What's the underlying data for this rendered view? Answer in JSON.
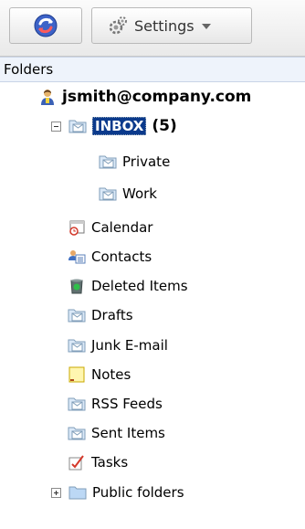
{
  "toolbar": {
    "refresh_icon": "refresh-icon",
    "settings_label": "Settings",
    "settings_icon": "settings-icon"
  },
  "folders_header": "Folders",
  "account": {
    "label": "jsmith@company.com",
    "icon": "user-icon"
  },
  "inbox": {
    "label": "INBOX",
    "count": "(5)",
    "expanded": true
  },
  "inbox_children": [
    {
      "label": "Private",
      "icon": "mail-folder-icon"
    },
    {
      "label": "Work",
      "icon": "mail-folder-icon"
    }
  ],
  "folders": [
    {
      "label": "Calendar",
      "icon": "calendar-icon"
    },
    {
      "label": "Contacts",
      "icon": "contacts-icon"
    },
    {
      "label": "Deleted Items",
      "icon": "recycle-bin-icon"
    },
    {
      "label": "Drafts",
      "icon": "mail-folder-icon"
    },
    {
      "label": "Junk E-mail",
      "icon": "mail-folder-icon"
    },
    {
      "label": "Notes",
      "icon": "notes-icon"
    },
    {
      "label": "RSS Feeds",
      "icon": "mail-folder-icon"
    },
    {
      "label": "Sent Items",
      "icon": "mail-folder-icon"
    },
    {
      "label": "Tasks",
      "icon": "tasks-icon"
    }
  ],
  "public_folders": {
    "label": "Public folders",
    "expanded": false,
    "icon": "folder-icon"
  },
  "colors": {
    "selection": "#0b3a8c",
    "folder_fill": "#dbe9f8",
    "folder_stroke": "#7f9db9"
  }
}
